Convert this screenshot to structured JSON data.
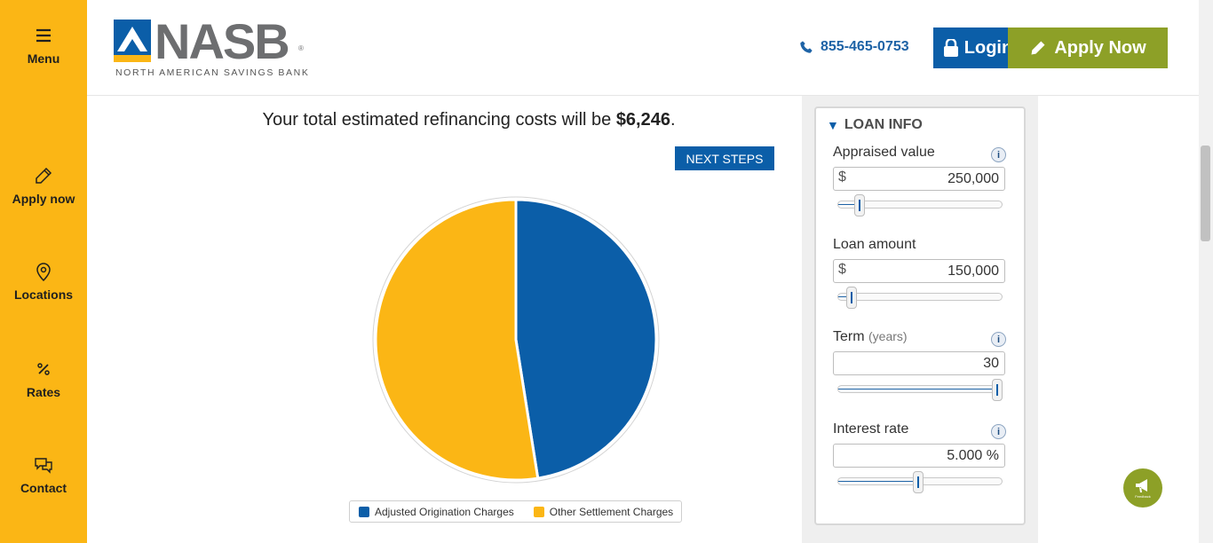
{
  "sidebar": {
    "menu_label": "Menu",
    "items": [
      {
        "label": "Apply now",
        "icon": "pencil-icon"
      },
      {
        "label": "Locations",
        "icon": "map-pin-icon"
      },
      {
        "label": "Rates",
        "icon": "percent-icon"
      },
      {
        "label": "Contact",
        "icon": "chat-bubbles-icon"
      }
    ]
  },
  "header": {
    "logo_word": "NASB",
    "logo_reg": "®",
    "logo_sub": "NORTH AMERICAN SAVINGS BANK",
    "phone": "855-465-0753",
    "login_label": "Login",
    "apply_label": "Apply Now"
  },
  "main": {
    "headline_prefix": "Your total estimated refinancing costs will be ",
    "headline_amount": "$6,246",
    "headline_suffix": ".",
    "next_steps_label": "NEXT STEPS"
  },
  "chart_data": {
    "type": "pie",
    "slices": [
      {
        "name": "Adjusted Origination Charges",
        "value": 47.5,
        "color": "#0b5ea8"
      },
      {
        "name": "Other Settlement Charges",
        "value": 52.5,
        "color": "#fbb615"
      }
    ],
    "legend_placement": "bottom"
  },
  "loan_info": {
    "title": "LOAN INFO",
    "fields": [
      {
        "label": "Appraised value",
        "unit": "",
        "prefix": "$",
        "value": "250,000",
        "slider_fraction": 0.11
      },
      {
        "label": "Loan amount",
        "unit": "",
        "prefix": "$",
        "value": "150,000",
        "slider_fraction": 0.06
      },
      {
        "label": "Term",
        "unit": "(years)",
        "prefix": "",
        "value": "30",
        "slider_fraction": 1.0
      },
      {
        "label": "Interest rate",
        "unit": "",
        "prefix": "",
        "value": "5.000 %",
        "slider_fraction": 0.49
      }
    ],
    "info_label": "i"
  },
  "feedback_label": "Feedback",
  "colors": {
    "accent_yellow": "#fbb615",
    "brand_blue": "#0b5ea8",
    "apply_green": "#8da027"
  }
}
